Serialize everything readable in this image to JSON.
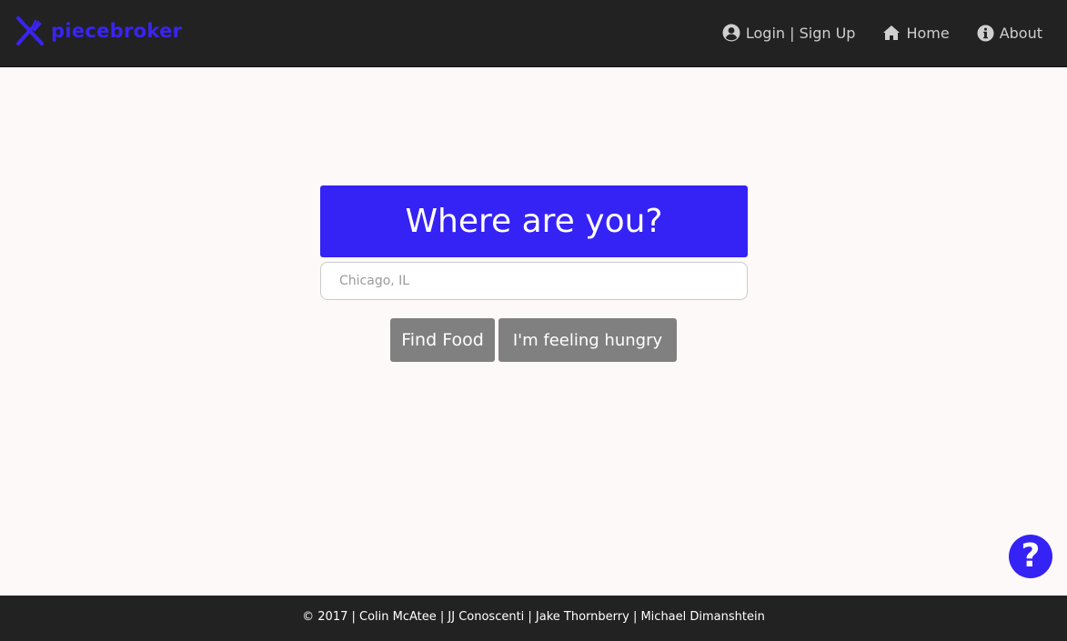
{
  "brand": {
    "name": "piecebroker",
    "icon": "fork-knife-icon",
    "color": "#3a24f0"
  },
  "nav": {
    "items": [
      {
        "label": "Login | Sign Up",
        "icon": "user-circle-icon"
      },
      {
        "label": "Home",
        "icon": "home-icon"
      },
      {
        "label": "About",
        "icon": "info-circle-icon"
      }
    ]
  },
  "search": {
    "heading": "Where are you?",
    "placeholder": "Chicago, IL",
    "value": "",
    "find_label": "Find Food",
    "hungry_label": "I'm feeling hungry"
  },
  "help": {
    "symbol": "?",
    "icon": "question-icon"
  },
  "footer": {
    "text": "© 2017 | Colin McAtee | JJ Conoscenti | Jake Thornberry | Michael Dimanshtein"
  },
  "colors": {
    "accent": "#3522f5",
    "nav_bg": "#222222",
    "page_bg": "#fdf9f8",
    "button_gray": "#808080"
  }
}
